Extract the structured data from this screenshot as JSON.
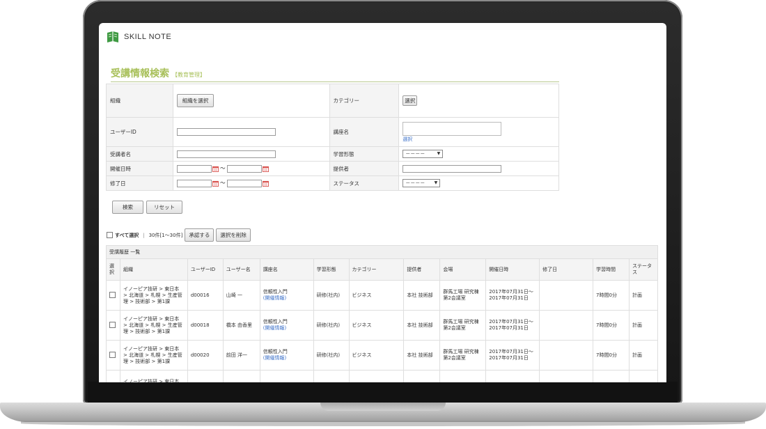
{
  "app": {
    "logo_text": "SKILL NOTE"
  },
  "page": {
    "title": "受講情報検索",
    "subtitle": "【教育管理】"
  },
  "form": {
    "org_label": "組織",
    "org_button": "組織を選択",
    "category_label": "カテゴリー",
    "category_button": "選択",
    "user_id_label": "ユーザーID",
    "course_label": "講座名",
    "course_select_link": "選択",
    "learner_label": "受講者名",
    "learning_form_label": "学習形態",
    "learning_form_value": "－－－－",
    "held_date_label": "開催日時",
    "provider_label": "提供者",
    "completion_label": "修了日",
    "status_label": "ステータス",
    "status_value": "－－－－",
    "range_sep": "～",
    "search_button": "検索",
    "reset_button": "リセット"
  },
  "bulk": {
    "select_all": "すべて選択",
    "divider": "|",
    "count": "30件[1～30件]",
    "approve_button": "承認する",
    "delete_button": "選択を削除"
  },
  "results": {
    "caption": "受講履歴 一覧",
    "columns": [
      "選択",
      "組織",
      "ユーザーID",
      "ユーザー名",
      "講座名",
      "学習形態",
      "カテゴリー",
      "提供者",
      "会場",
      "開催日時",
      "修了日",
      "学習時間",
      "ステータス"
    ],
    "rows": [
      {
        "org": "イノーピア技研 > 東日本 > 北海道 > 札幌 > 生産管理 > 技術部 > 第1課",
        "user_id": "d00016",
        "user_name": "山崎 一",
        "course": "信頼性入門",
        "course_link": "(開催情報)",
        "form": "研修(社内)",
        "category": "ビジネス",
        "provider": "本社 技術部",
        "venue": "群馬工場 研究棟 第2会議室",
        "date": "2017年07月31日～2017年07月31日",
        "completed": "",
        "time": "7時間0分",
        "status": "計画"
      },
      {
        "org": "イノーピア技研 > 東日本 > 北海道 > 札幌 > 生産管理 > 技術部 > 第1課",
        "user_id": "d00018",
        "user_name": "橋本 由香里",
        "course": "信頼性入門",
        "course_link": "(開催情報)",
        "form": "研修(社内)",
        "category": "ビジネス",
        "provider": "本社 技術部",
        "venue": "群馬工場 研究棟 第2会議室",
        "date": "2017年07月31日～2017年07月31日",
        "completed": "",
        "time": "7時間0分",
        "status": "計画"
      },
      {
        "org": "イノーピア技研 > 東日本 > 北海道 > 札幌 > 生産管理 > 技術部 > 第1課",
        "user_id": "d00020",
        "user_name": "前田 洋一",
        "course": "信頼性入門",
        "course_link": "(開催情報)",
        "form": "研修(社内)",
        "category": "ビジネス",
        "provider": "本社 技術部",
        "venue": "群馬工場 研究棟 第2会議室",
        "date": "2017年07月31日～2017年07月31日",
        "completed": "",
        "time": "7時間0分",
        "status": "計画"
      },
      {
        "org": "イノーピア技研 > 東日本 >",
        "user_id": "",
        "user_name": "",
        "course": "",
        "course_link": "",
        "form": "",
        "category": "",
        "provider": "",
        "venue": "",
        "date": "",
        "completed": "",
        "time": "",
        "status": ""
      }
    ]
  },
  "colors": {
    "accent": "#a8c05a",
    "link": "#3a6fc8",
    "calendar": "#d9534f"
  }
}
